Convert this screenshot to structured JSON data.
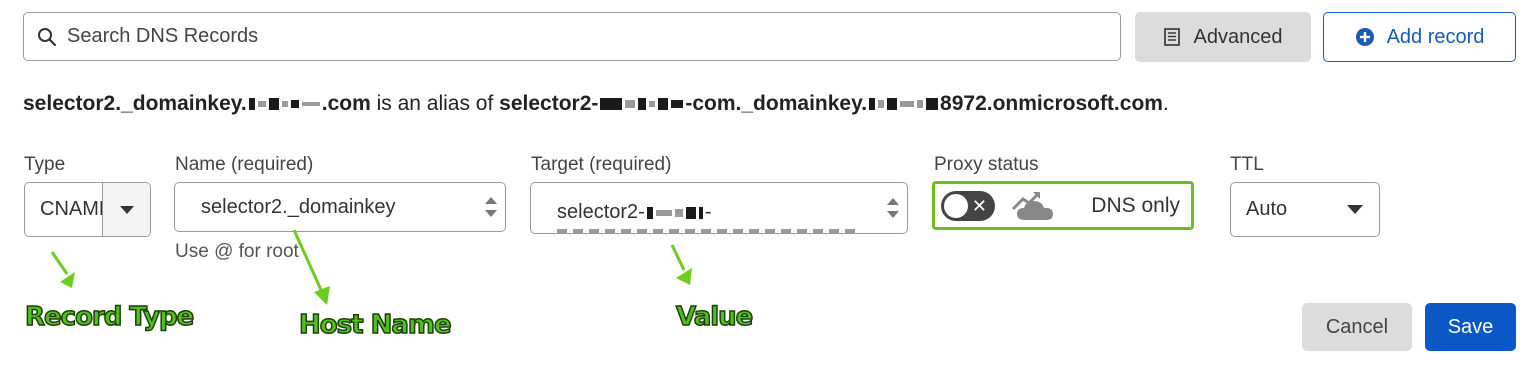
{
  "search": {
    "placeholder": "Search DNS Records"
  },
  "toolbar": {
    "advanced_label": "Advanced",
    "add_record_label": "Add record"
  },
  "alias_line": {
    "part1": "selector2._domainkey.",
    "part2": ".com",
    "middle": " is an alias of ",
    "part3": "selector2-",
    "part4": "-com._domainkey.",
    "part5": "8972.onmicrosoft.com",
    "end": "."
  },
  "form": {
    "type_label": "Type",
    "type_value": "CNAME",
    "name_label": "Name (required)",
    "name_value": "selector2._domainkey",
    "name_hint": "Use @ for root",
    "target_label": "Target (required)",
    "target_value": "selector2-",
    "proxy_label": "Proxy status",
    "proxy_value": "DNS only",
    "ttl_label": "TTL",
    "ttl_value": "Auto"
  },
  "annotations": {
    "record_type": "Record Type",
    "host_name": "Host Name",
    "value": "Value"
  },
  "actions": {
    "cancel_label": "Cancel",
    "save_label": "Save"
  },
  "colors": {
    "accent": "#0b57c5",
    "annotation": "#4ec21a",
    "proxy_border": "#6abf22"
  },
  "icons": [
    "search-icon",
    "advanced-icon",
    "plus-circle-icon",
    "chevron-down-icon",
    "close-icon",
    "cloud-icon"
  ]
}
